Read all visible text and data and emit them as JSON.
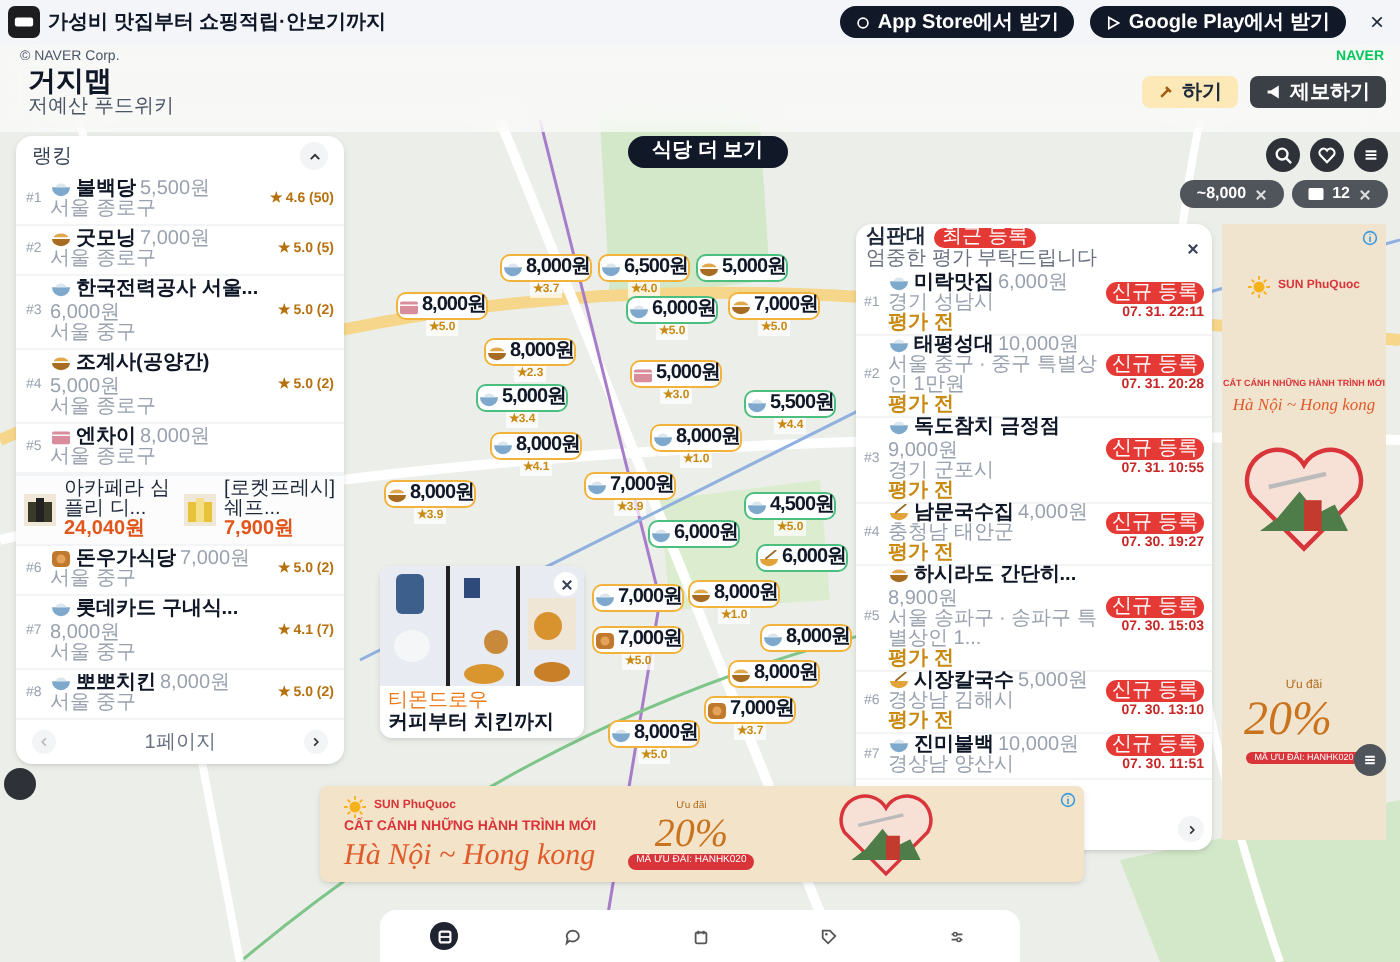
{
  "app_banner": {
    "tagline": "가성비 맛집부터 쇼핑적립·안보기까지",
    "buttons": [
      {
        "kind": "apple",
        "label": "App Store에서 받기"
      },
      {
        "kind": "play",
        "label": "Google Play에서 받기"
      }
    ],
    "close": "×"
  },
  "map_attribution": "© NAVER Corp.",
  "map_logo": "NAVER",
  "header": {
    "title": "거지맵",
    "subtitle": "저예산 푸드위키",
    "buttons": [
      {
        "kind": "primary",
        "label": "하기"
      },
      {
        "kind": "secondary",
        "label": "제보하기"
      }
    ]
  },
  "more_button": "식당 더 보기",
  "filters": [
    {
      "kind": "price",
      "label": "~8,000"
    },
    {
      "kind": "count",
      "label": "12"
    }
  ],
  "ranking": {
    "title": "랭킹",
    "items": [
      {
        "rank": "#1",
        "kind": "bowl",
        "name": "불백당",
        "price": "5,500원",
        "region": "서울 종로구",
        "rating": "★ 4.6 (50)"
      },
      {
        "rank": "#2",
        "kind": "pot",
        "name": "굿모닝",
        "price": "7,000원",
        "region": "서울 종로구",
        "rating": "★ 5.0 (5)"
      },
      {
        "rank": "#3",
        "kind": "bowl",
        "name": "한국전력공사 서울...",
        "price": "6,000원",
        "region": "서울 중구",
        "rating": "★ 5.0 (2)"
      },
      {
        "rank": "#4",
        "kind": "pot",
        "name": "조계사(공양간)",
        "price": "5,000원",
        "region": "서울 종로구",
        "rating": "★ 5.0 (2)"
      },
      {
        "rank": "#5",
        "kind": "box",
        "name": "엔차이",
        "price": "8,000원",
        "region": "서울 종로구"
      },
      {
        "kind": "ads",
        "ads": [
          {
            "name": "아카페라 심플리 디...",
            "price": "24,040원"
          },
          {
            "name": "[로켓프레시] 쉐프...",
            "price": "7,900원"
          }
        ]
      },
      {
        "rank": "#6",
        "kind": "chicken",
        "name": "돈우가식당",
        "price": "7,000원",
        "region": "서울 중구",
        "rating": "★ 5.0 (2)"
      },
      {
        "rank": "#7",
        "kind": "bowl",
        "name": "롯데카드 구내식...",
        "price": "8,000원",
        "region": "서울 중구",
        "rating": "★ 4.1 (7)"
      },
      {
        "rank": "#8",
        "kind": "bowl",
        "name": "뽀뽀치킨",
        "price": "8,000원",
        "region": "서울 중구",
        "rating": "★ 5.0 (2)"
      }
    ],
    "page": "1페이지"
  },
  "review_board": {
    "title": "심판대",
    "badge": "최근 등록",
    "subtitle": "엄중한 평가 부탁드립니다",
    "items": [
      {
        "rank": "#1",
        "kind": "bowl",
        "name": "미락맛집",
        "price": "6,000원",
        "region": "경기 성남시",
        "status": "평가 전",
        "badge": "신규 등록",
        "time": "07. 31. 22:11"
      },
      {
        "rank": "#2",
        "kind": "bowl",
        "name": "태평성대",
        "price": "10,000원",
        "region": "서울 중구 · 중구 특별상인 1만원",
        "status": "평가 전",
        "badge": "신규 등록",
        "time": "07. 31. 20:28"
      },
      {
        "rank": "#3",
        "kind": "bowl",
        "name": "독도참치 금정점",
        "price": "9,000원",
        "region": "경기 군포시",
        "status": "평가 전",
        "badge": "신규 등록",
        "time": "07. 31. 10:55"
      },
      {
        "rank": "#4",
        "kind": "noodle",
        "name": "남문국수집",
        "price": "4,000원",
        "region": "충청남 태안군",
        "status": "평가 전",
        "badge": "신규 등록",
        "time": "07. 30. 19:27"
      },
      {
        "rank": "#5",
        "kind": "pot",
        "name": "하시라도 간단히...",
        "price": "8,900원",
        "region": "서울 송파구 · 송파구 특별상인 1...",
        "status": "평가 전",
        "badge": "신규 등록",
        "time": "07. 30. 15:03"
      },
      {
        "rank": "#6",
        "kind": "noodle",
        "name": "시장칼국수",
        "price": "5,000원",
        "region": "경상남 김해시",
        "status": "평가 전",
        "badge": "신규 등록",
        "time": "07. 30. 13:10"
      },
      {
        "rank": "#7",
        "kind": "bowl",
        "name": "진미불백",
        "price": "10,000원",
        "region": "경상남 양산시",
        "badge": "신규 등록",
        "time": "07. 30. 11:51"
      }
    ]
  },
  "markers": [
    {
      "price": "8,000원",
      "rating": "★3.7",
      "kind": "bowl",
      "color": "#f2b33d"
    },
    {
      "price": "6,500원",
      "rating": "★4.0",
      "kind": "bowl",
      "color": "#f2b33d"
    },
    {
      "price": "5,000원",
      "kind": "pot",
      "color": "#4cbf7f"
    },
    {
      "price": "8,000원",
      "rating": "★5.0",
      "kind": "box",
      "color": "#f2b33d"
    },
    {
      "price": "6,000원",
      "rating": "★5.0",
      "kind": "bowl",
      "color": "#4cbf7f"
    },
    {
      "price": "7,000원",
      "rating": "★5.0",
      "kind": "pot",
      "color": "#f2b33d"
    },
    {
      "price": "8,000원",
      "rating": "★2.3",
      "kind": "pot",
      "color": "#f2b33d"
    },
    {
      "price": "5,000원",
      "rating": "★3.0",
      "kind": "box",
      "color": "#f2b33d"
    },
    {
      "price": "5,000원",
      "rating": "★3.4",
      "kind": "bowl",
      "color": "#4cbf7f"
    },
    {
      "price": "5,500원",
      "rating": "★4.4",
      "kind": "bowl",
      "color": "#4cbf7f"
    },
    {
      "price": "8,000원",
      "rating": "★4.1",
      "kind": "bowl",
      "color": "#f2b33d"
    },
    {
      "price": "8,000원",
      "rating": "★1.0",
      "kind": "bowl",
      "color": "#f2b33d"
    },
    {
      "price": "8,000원",
      "rating": "★3.9",
      "kind": "pot",
      "color": "#f2b33d"
    },
    {
      "price": "7,000원",
      "rating": "★3.9",
      "kind": "bowl",
      "color": "#f2b33d"
    },
    {
      "price": "4,500원",
      "rating": "★5.0",
      "kind": "bowl",
      "color": "#4cbf7f"
    },
    {
      "price": "6,000원",
      "kind": "bowl",
      "color": "#4cbf7f"
    },
    {
      "price": "6,000원",
      "kind": "noodle",
      "color": "#4cbf7f"
    },
    {
      "price": "7,000원",
      "kind": "bowl",
      "color": "#f2b33d"
    },
    {
      "price": "8,000원",
      "rating": "★1.0",
      "kind": "pot",
      "color": "#f2b33d"
    },
    {
      "price": "7,000원",
      "rating": "★5.0",
      "kind": "chicken",
      "color": "#f2b33d"
    },
    {
      "price": "8,000원",
      "kind": "bowl",
      "color": "#f2b33d"
    },
    {
      "price": "8,000원",
      "kind": "pot",
      "color": "#f2b33d"
    },
    {
      "price": "7,000원",
      "rating": "★3.7",
      "kind": "chicken",
      "color": "#f2b33d"
    },
    {
      "price": "8,000원",
      "rating": "★5.0",
      "kind": "bowl",
      "color": "#f2b33d"
    }
  ],
  "promo_card": {
    "brand": "티몬드로우",
    "title": "커피부터 치킨까지"
  },
  "banner_ad": {
    "brand": "SUN PhuQuoc",
    "headline": "CẤT CÁNH NHỮNG HÀNH TRÌNH MỚI",
    "route": "Hà Nội ~ Hong kong",
    "offer_label": "Ưu đãi",
    "discount": "20%",
    "code": "MÃ ƯU ĐÃI: HANHK020"
  },
  "side_ad": {
    "brand": "SUN PhuQuoc",
    "headline": "CẤT CÁNH NHỮNG HÀNH TRÌNH MỚI",
    "route": "Hà Nội ~ Hong kong",
    "offer_label": "Ưu đãi",
    "discount": "20%",
    "code": "MÃ ƯU ĐÃI: HANHK020"
  },
  "nav": [
    {
      "kind": "map",
      "selected": true
    },
    {
      "kind": "chat",
      "selected": false
    },
    {
      "kind": "calendar",
      "selected": false
    },
    {
      "kind": "tag",
      "selected": false
    },
    {
      "kind": "sliders",
      "selected": false
    }
  ]
}
